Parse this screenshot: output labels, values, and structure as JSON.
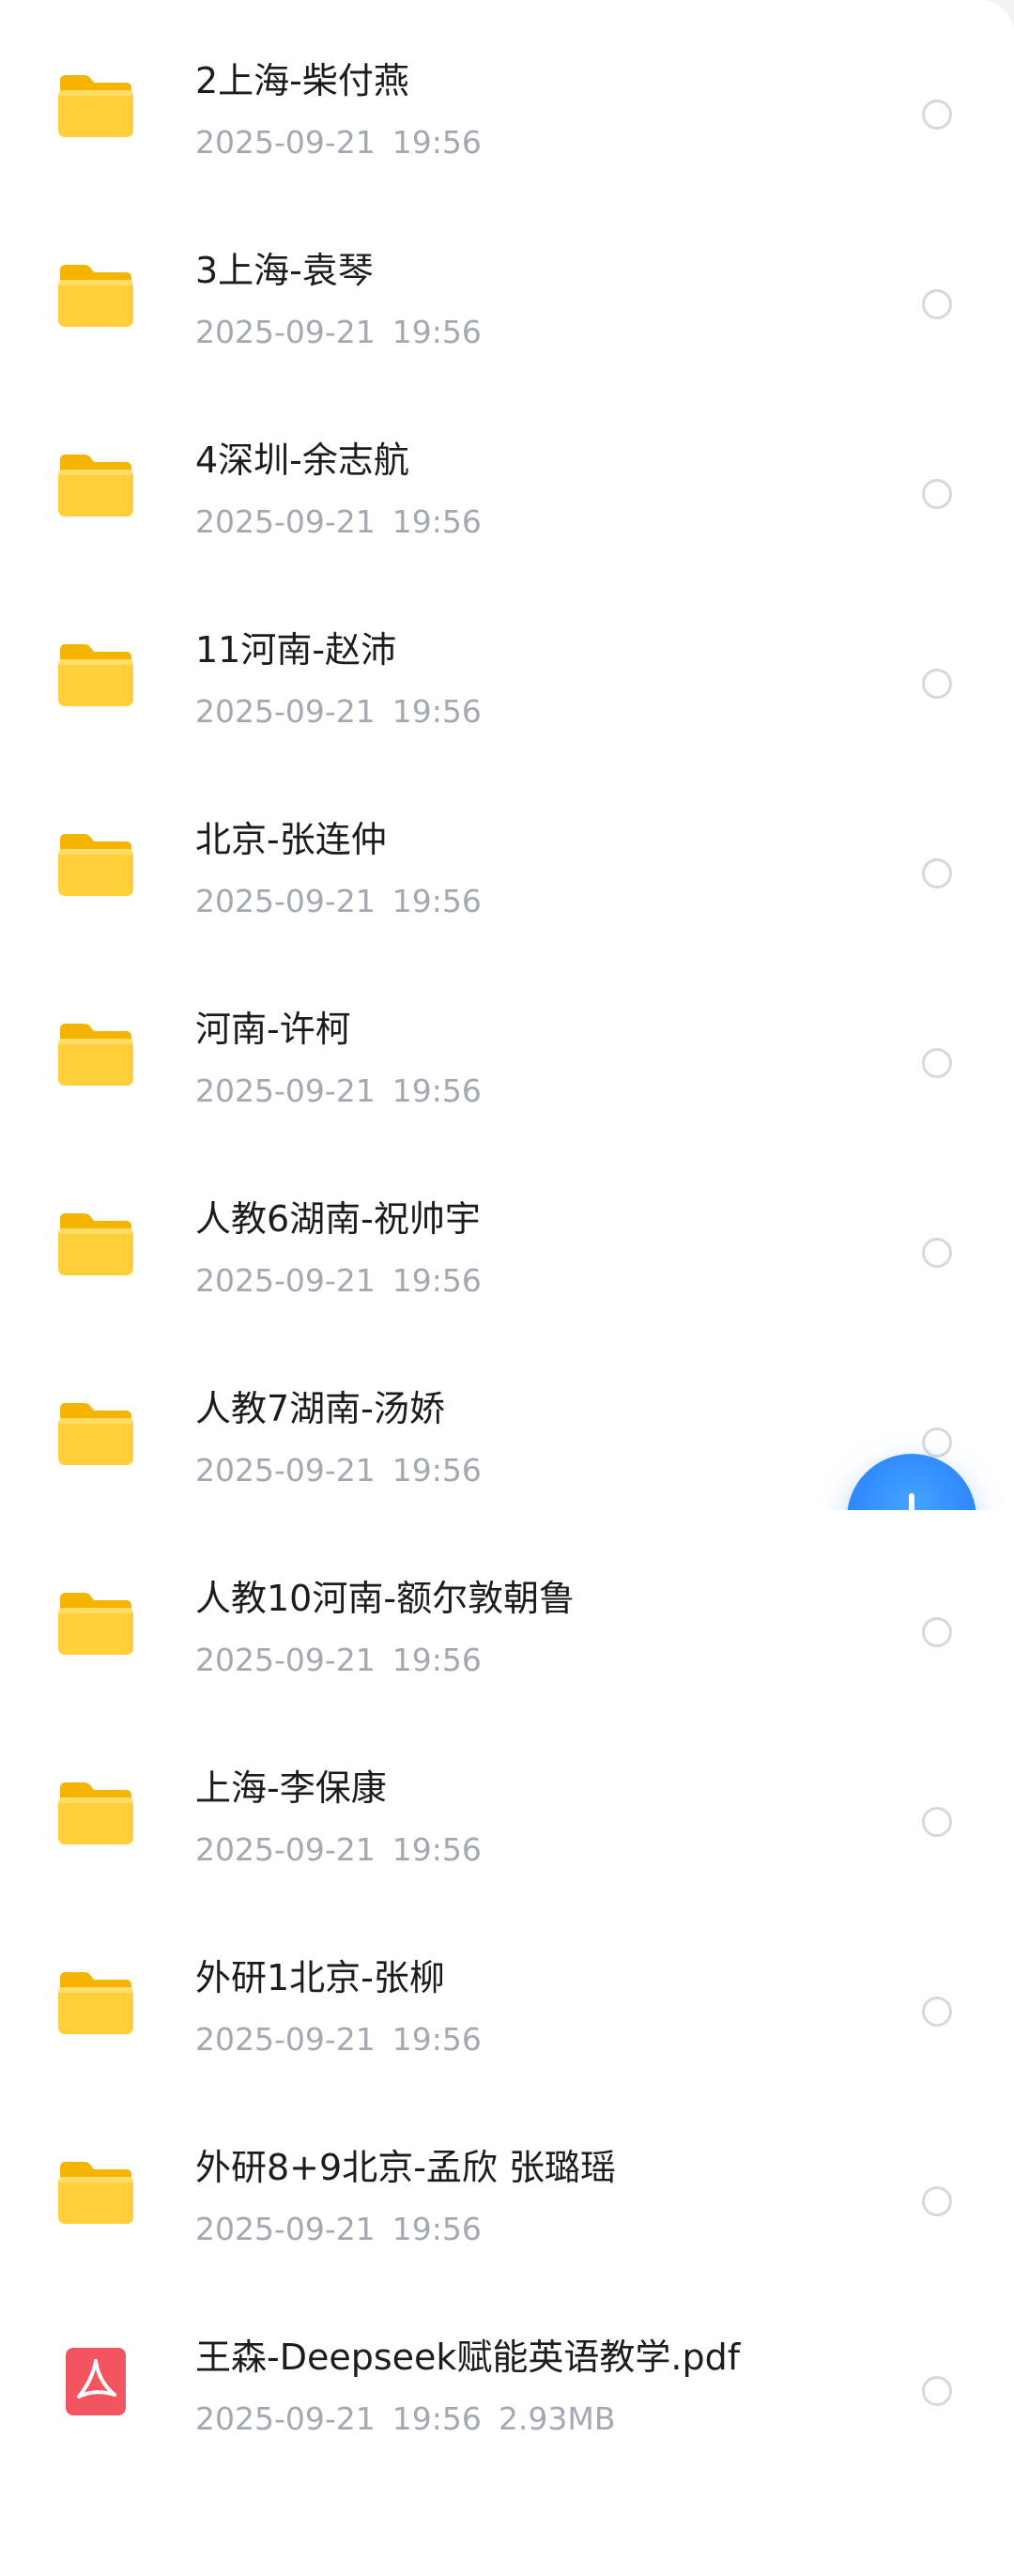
{
  "colors": {
    "folder_front": "#ffcf3a",
    "folder_back": "#f5b400",
    "pdf_red": "#f25460",
    "fab_blue": "#2a84ff"
  },
  "files": [
    {
      "icon": "folder-icon",
      "name": "2上海-柴付燕",
      "date": "2025-09-21",
      "time": "19:56",
      "size": ""
    },
    {
      "icon": "folder-icon",
      "name": "3上海-袁琴",
      "date": "2025-09-21",
      "time": "19:56",
      "size": ""
    },
    {
      "icon": "folder-icon",
      "name": "4深圳-余志航",
      "date": "2025-09-21",
      "time": "19:56",
      "size": ""
    },
    {
      "icon": "folder-icon",
      "name": "11河南-赵沛",
      "date": "2025-09-21",
      "time": "19:56",
      "size": ""
    },
    {
      "icon": "folder-icon",
      "name": "北京-张连仲",
      "date": "2025-09-21",
      "time": "19:56",
      "size": ""
    },
    {
      "icon": "folder-icon",
      "name": "河南-许柯",
      "date": "2025-09-21",
      "time": "19:56",
      "size": ""
    },
    {
      "icon": "folder-icon",
      "name": "人教6湖南-祝帅宇",
      "date": "2025-09-21",
      "time": "19:56",
      "size": ""
    },
    {
      "icon": "folder-icon",
      "name": "人教7湖南-汤娇",
      "date": "2025-09-21",
      "time": "19:56",
      "size": ""
    },
    {
      "icon": "folder-icon",
      "name": "人教10河南-额尔敦朝鲁",
      "date": "2025-09-21",
      "time": "19:56",
      "size": ""
    },
    {
      "icon": "folder-icon",
      "name": "上海-李保康",
      "date": "2025-09-21",
      "time": "19:56",
      "size": ""
    },
    {
      "icon": "folder-icon",
      "name": "外研1北京-张柳",
      "date": "2025-09-21",
      "time": "19:56",
      "size": ""
    },
    {
      "icon": "folder-icon",
      "name": "外研8+9北京-孟欣 张璐瑶",
      "date": "2025-09-21",
      "time": "19:56",
      "size": ""
    },
    {
      "icon": "pdf-icon",
      "name": "王森-Deepseek赋能英语教学.pdf",
      "date": "2025-09-21",
      "time": "19:56",
      "size": "2.93MB"
    }
  ],
  "fab": {
    "icon": "plus-icon"
  }
}
